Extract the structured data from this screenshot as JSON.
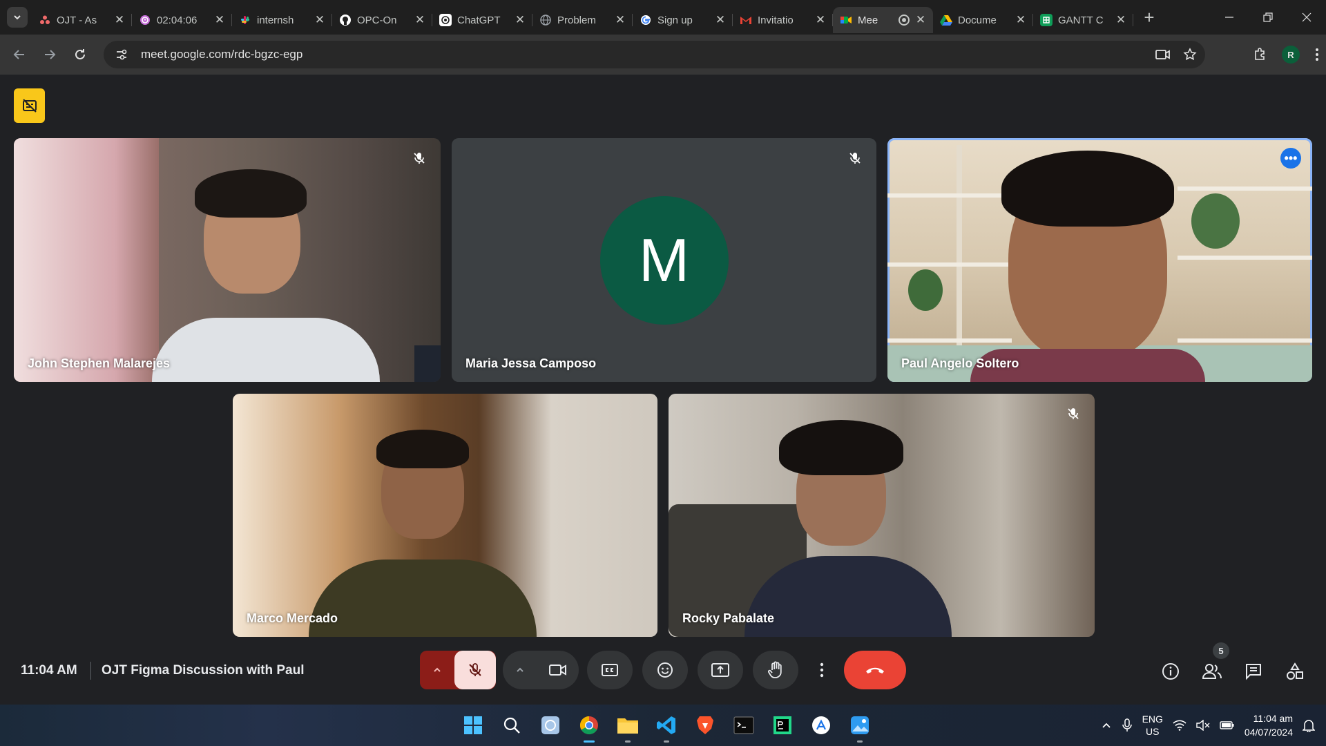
{
  "browser": {
    "tabs": [
      {
        "title": "OJT - As",
        "favicon": "asana-icon",
        "color": "#f06a6a"
      },
      {
        "title": "02:04:06",
        "favicon": "timer-icon",
        "color": "#c46bd6"
      },
      {
        "title": "internsh",
        "favicon": "slack-icon",
        "color": "#e01e5a"
      },
      {
        "title": "OPC-On",
        "favicon": "github-icon",
        "color": "#ffffff"
      },
      {
        "title": "ChatGPT",
        "favicon": "chatgpt-icon",
        "color": "#ffffff"
      },
      {
        "title": "Problem",
        "favicon": "globe-icon",
        "color": "#9aa0a6"
      },
      {
        "title": "Sign up",
        "favicon": "google-icon",
        "color": "#4285f4"
      },
      {
        "title": "Invitatio",
        "favicon": "gmail-icon",
        "color": "#ea4335"
      },
      {
        "title": "Mee",
        "favicon": "meet-icon",
        "color": "#00ac47",
        "active": true
      },
      {
        "title": "Docume",
        "favicon": "drive-icon",
        "color": "#fbbc04"
      },
      {
        "title": "GANTT C",
        "favicon": "sheets-icon",
        "color": "#0f9d58"
      }
    ],
    "url": "meet.google.com/rdc-bgzc-egp",
    "profile_initial": "R"
  },
  "meet": {
    "participants": [
      {
        "name": "John Stephen Malarejes",
        "muted": true,
        "camera": true
      },
      {
        "name": "Maria Jessa Camposo",
        "muted": true,
        "camera": false,
        "avatar_letter": "M",
        "avatar_color": "#0b5a43"
      },
      {
        "name": "Paul Angelo Soltero",
        "muted": false,
        "camera": true,
        "speaking": true
      },
      {
        "name": "Marco Mercado",
        "muted": false,
        "camera": true
      },
      {
        "name": "Rocky Pabalate",
        "muted": true,
        "camera": true
      }
    ],
    "time": "11:04 AM",
    "title": "OJT Figma Discussion with Paul",
    "people_count": "5",
    "colors": {
      "leave": "#ea4335",
      "mic_off_bg": "#f9dedc",
      "speaking_outline": "#8ab4f8",
      "captions_badge": "#f9c71a"
    }
  },
  "taskbar": {
    "apps": [
      "windows-start-icon",
      "search-icon",
      "file-manager-icon",
      "chrome-icon",
      "file-explorer-icon",
      "vscode-icon",
      "brave-icon",
      "terminal-icon",
      "pycharm-icon",
      "app-store-icon",
      "photos-icon"
    ],
    "lang_line1": "ENG",
    "lang_line2": "US",
    "time": "11:04 am",
    "date": "04/07/2024"
  }
}
